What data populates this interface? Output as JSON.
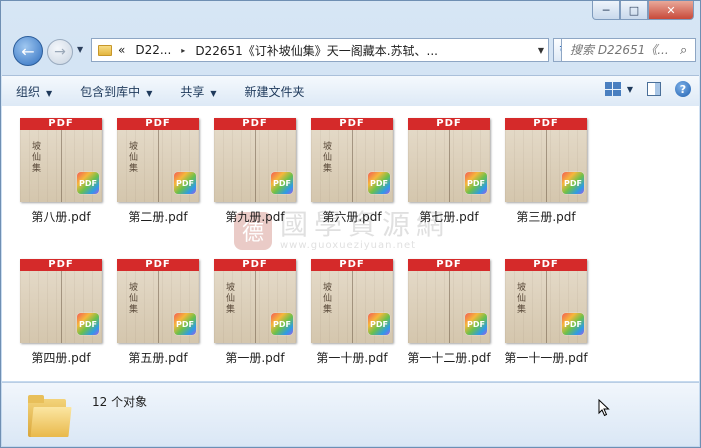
{
  "window": {
    "minimize": "─",
    "maximize": "□",
    "close": "✕"
  },
  "nav": {
    "back_icon": "←",
    "forward_icon": "→",
    "history_icon": "▼",
    "breadcrumb": [
      "«",
      "D22...",
      "▸",
      "D22651《订补坡仙集》天一阁藏本.苏轼、..."
    ],
    "refresh_icon": "↻",
    "search_placeholder": "搜索 D22651《...",
    "search_icon": "⌕"
  },
  "toolbar": {
    "items": [
      {
        "label": "组织",
        "arrow": "▼"
      },
      {
        "label": "包含到库中",
        "arrow": "▼"
      },
      {
        "label": "共享",
        "arrow": "▼"
      },
      {
        "label": "新建文件夹",
        "arrow": ""
      }
    ],
    "view_arrow": "▼",
    "help": "?"
  },
  "watermark": {
    "seal": "德",
    "text": "國學資源網",
    "url": "www.guoxueziyuan.net"
  },
  "files": [
    {
      "name": "第八册.pdf",
      "band": "PDF",
      "badge": "PDF",
      "glyphs": "坡仙集"
    },
    {
      "name": "第二册.pdf",
      "band": "PDF",
      "badge": "PDF",
      "glyphs": "坡仙集"
    },
    {
      "name": "第九册.pdf",
      "band": "PDF",
      "badge": "PDF",
      "glyphs": ""
    },
    {
      "name": "第六册.pdf",
      "band": "PDF",
      "badge": "PDF",
      "glyphs": "坡仙集"
    },
    {
      "name": "第七册.pdf",
      "band": "PDF",
      "badge": "PDF",
      "glyphs": ""
    },
    {
      "name": "第三册.pdf",
      "band": "PDF",
      "badge": "PDF",
      "glyphs": ""
    },
    {
      "name": "第四册.pdf",
      "band": "PDF",
      "badge": "PDF",
      "glyphs": ""
    },
    {
      "name": "第五册.pdf",
      "band": "PDF",
      "badge": "PDF",
      "glyphs": "坡仙集"
    },
    {
      "name": "第一册.pdf",
      "band": "PDF",
      "badge": "PDF",
      "glyphs": "坡仙集"
    },
    {
      "name": "第一十册.pdf",
      "band": "PDF",
      "badge": "PDF",
      "glyphs": "坡仙集"
    },
    {
      "name": "第一十二册.pdf",
      "band": "PDF",
      "badge": "PDF",
      "glyphs": ""
    },
    {
      "name": "第一十一册.pdf",
      "band": "PDF",
      "badge": "PDF",
      "glyphs": "坡仙集"
    }
  ],
  "status": {
    "count": "12 个对象"
  }
}
